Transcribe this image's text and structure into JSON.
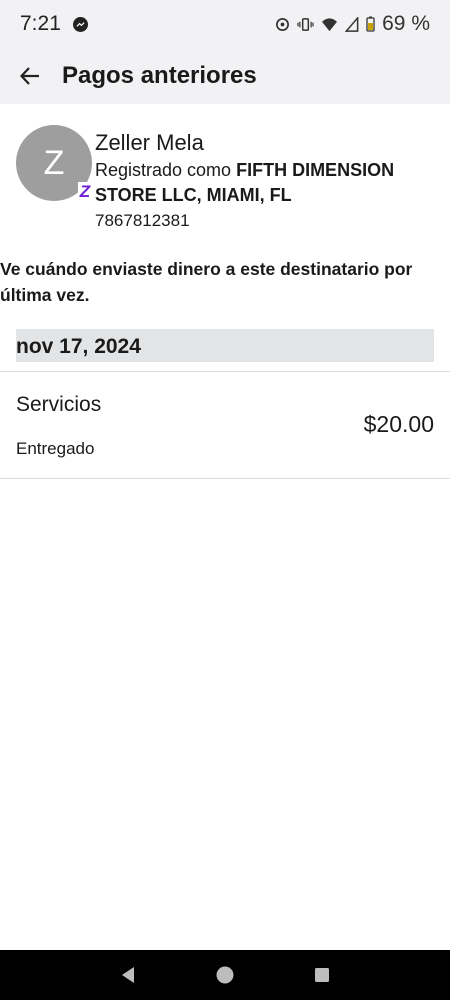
{
  "status_bar": {
    "time": "7:21",
    "battery": "69 %"
  },
  "app_bar": {
    "title": "Pagos anteriores"
  },
  "recipient": {
    "initial": "Z",
    "name": "Zeller Mela",
    "registered_prefix": "Registrado como ",
    "registered_name": "FIFTH DIMENSION STORE LLC, MIAMI, FL",
    "phone": "7867812381",
    "badge": "Z"
  },
  "description": "Ve cuándo enviaste dinero a este destinatario por última vez.",
  "payments": {
    "date": "nov 17, 2024",
    "items": [
      {
        "label": "Servicios",
        "status": "Entregado",
        "amount": "$20.00"
      }
    ]
  },
  "colors": {
    "zelle_purple": "#6d1ed4",
    "avatar_gray": "#9e9e9e",
    "header_bg": "#f2f2f4",
    "date_bg": "#e3e4e6"
  }
}
